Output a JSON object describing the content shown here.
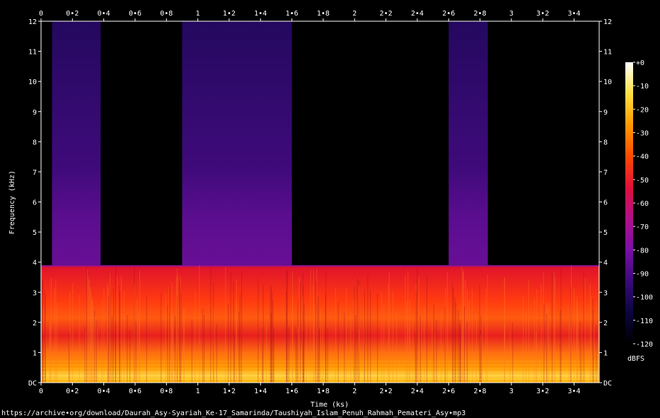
{
  "chart_data": {
    "type": "heatmap",
    "title": "",
    "xlabel": "Time (ks)",
    "ylabel": "Frequency (kHz)",
    "xlim": [
      0,
      3.56
    ],
    "ylim": [
      0,
      12
    ],
    "x_ticks": [
      {
        "value": 0,
        "label": "0"
      },
      {
        "value": 0.2,
        "label": "0•2"
      },
      {
        "value": 0.4,
        "label": "0•4"
      },
      {
        "value": 0.6,
        "label": "0•6"
      },
      {
        "value": 0.8,
        "label": "0•8"
      },
      {
        "value": 1.0,
        "label": "1"
      },
      {
        "value": 1.2,
        "label": "1•2"
      },
      {
        "value": 1.4,
        "label": "1•4"
      },
      {
        "value": 1.6,
        "label": "1•6"
      },
      {
        "value": 1.8,
        "label": "1•8"
      },
      {
        "value": 2.0,
        "label": "2"
      },
      {
        "value": 2.2,
        "label": "2•2"
      },
      {
        "value": 2.4,
        "label": "2•4"
      },
      {
        "value": 2.6,
        "label": "2•6"
      },
      {
        "value": 2.8,
        "label": "2•8"
      },
      {
        "value": 3.0,
        "label": "3"
      },
      {
        "value": 3.2,
        "label": "3•2"
      },
      {
        "value": 3.4,
        "label": "3•4"
      }
    ],
    "y_ticks": [
      {
        "value": 0,
        "label": "DC"
      },
      {
        "value": 1,
        "label": "1"
      },
      {
        "value": 2,
        "label": "2"
      },
      {
        "value": 3,
        "label": "3"
      },
      {
        "value": 4,
        "label": "4"
      },
      {
        "value": 5,
        "label": "5"
      },
      {
        "value": 6,
        "label": "6"
      },
      {
        "value": 7,
        "label": "7"
      },
      {
        "value": 8,
        "label": "8"
      },
      {
        "value": 9,
        "label": "9"
      },
      {
        "value": 10,
        "label": "10"
      },
      {
        "value": 11,
        "label": "11"
      },
      {
        "value": 12,
        "label": "12"
      }
    ],
    "colorbar": {
      "label": "dBFS",
      "range": [
        -120,
        0
      ],
      "ticks": [
        {
          "value": 0,
          "label": "+0"
        },
        {
          "value": -10,
          "label": "-10"
        },
        {
          "value": -20,
          "label": "-20"
        },
        {
          "value": -30,
          "label": "-30"
        },
        {
          "value": -40,
          "label": "-40"
        },
        {
          "value": -50,
          "label": "-50"
        },
        {
          "value": -60,
          "label": "-60"
        },
        {
          "value": -70,
          "label": "-70"
        },
        {
          "value": -80,
          "label": "-80"
        },
        {
          "value": -90,
          "label": "-90"
        },
        {
          "value": -100,
          "label": "-100"
        },
        {
          "value": -110,
          "label": "-110"
        },
        {
          "value": -120,
          "label": "-120"
        }
      ],
      "colors": [
        "#000000",
        "#0b0540",
        "#3a0a7a",
        "#7a0fa6",
        "#b0108a",
        "#e0103a",
        "#ff4a00",
        "#ff9a00",
        "#ffe040",
        "#ffffff"
      ]
    },
    "upper_band_segments_ks": [
      [
        0.07,
        0.38
      ],
      [
        0.9,
        1.6
      ],
      [
        2.6,
        2.85
      ]
    ],
    "content_cutoff_khz": 3.9,
    "footer_text": "https://archive•org/download/Daurah_Asy-Syariah_Ke-17_Samarinda/Taushiyah_Islam_Penuh_Rahmah_Pemateri_Asy•mp3"
  }
}
